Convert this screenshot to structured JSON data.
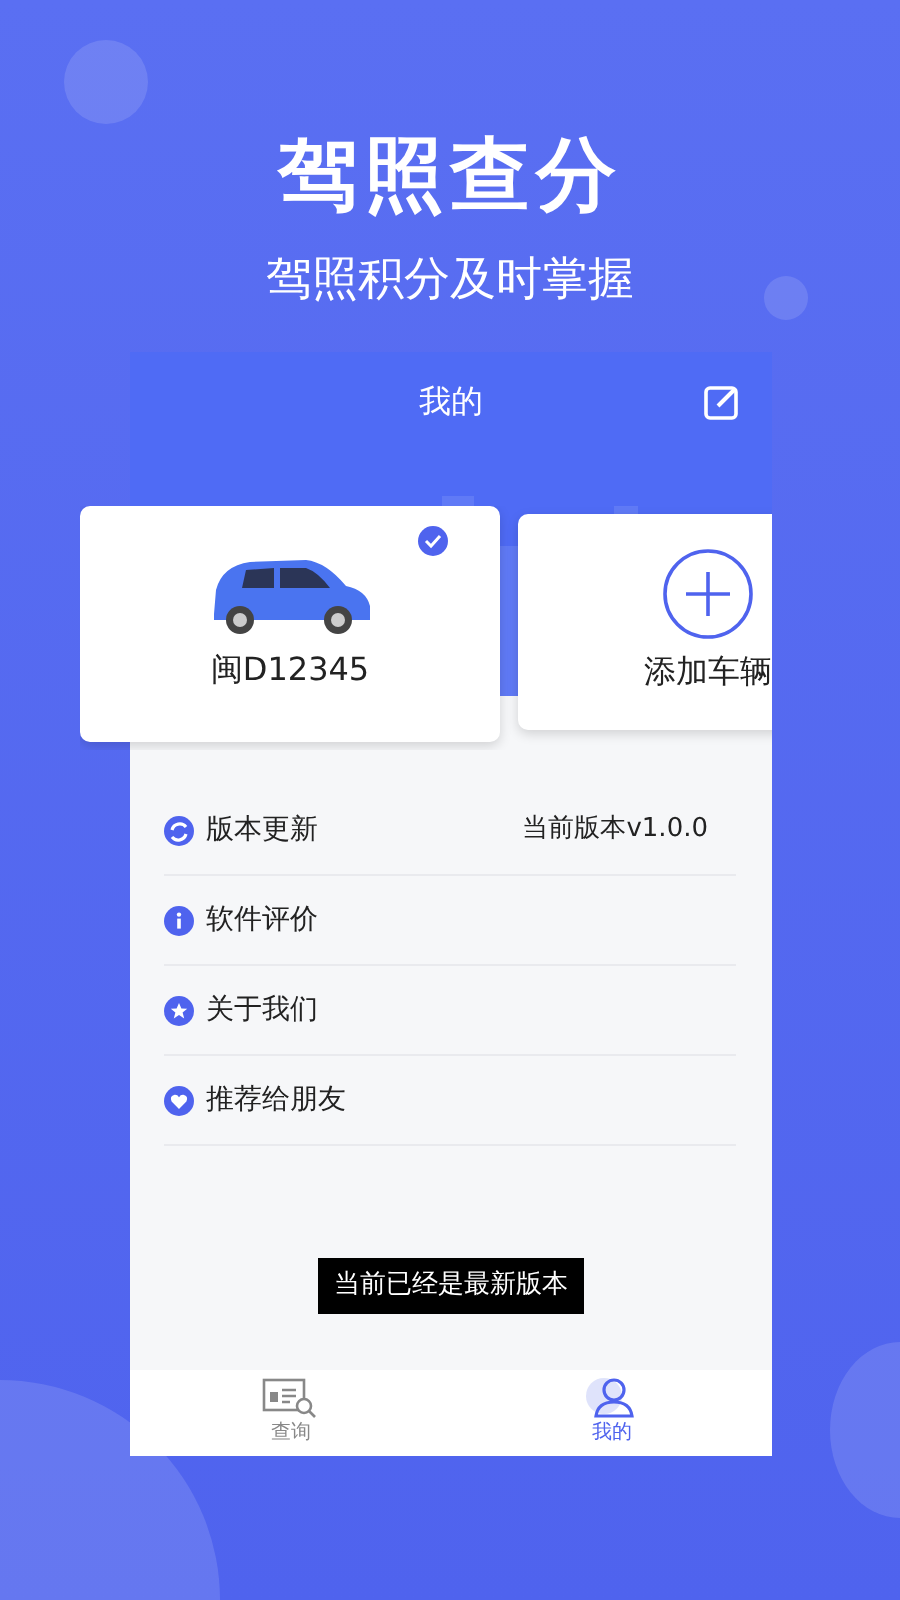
{
  "headline": "驾照查分",
  "subheadline": "驾照积分及时掌握",
  "screen": {
    "title": "我的",
    "vehicles": [
      {
        "kind": "car",
        "plate": "闽D12345",
        "selected": true
      },
      {
        "kind": "add",
        "label": "添加车辆",
        "selected": false
      }
    ],
    "menu": [
      {
        "kind": "update",
        "label": "版本更新",
        "value": "当前版本v1.0.0"
      },
      {
        "kind": "info",
        "label": "软件评价"
      },
      {
        "kind": "star",
        "label": "关于我们"
      },
      {
        "kind": "heart",
        "label": "推荐给朋友"
      }
    ],
    "toast": "当前已经是最新版本",
    "tabs": [
      {
        "kind": "query",
        "label": "查询",
        "selected": false
      },
      {
        "kind": "profile",
        "label": "我的",
        "selected": true
      }
    ]
  }
}
